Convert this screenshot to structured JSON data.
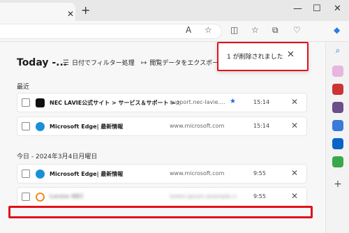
{
  "window": {
    "tab_close": "✕",
    "new_tab": "+",
    "minimize": "—",
    "maximize": "☐",
    "close": "✕"
  },
  "toolbar": {
    "read_aloud": "A",
    "favorite": "☆",
    "split": "◫",
    "favorites_bar": "☆",
    "collections": "⧉",
    "extensions": "♡",
    "copilot": "◆"
  },
  "page": {
    "title": "Today -...",
    "filter_label": "日付でフィルター処理",
    "export_label": "閲覧データをエクスポート"
  },
  "toast": {
    "message": "1 が削除されました",
    "close": "✕"
  },
  "sections": [
    {
      "label": "最近",
      "rows": [
        {
          "title": "NEC LAVIE公式サイト > サービス＆サポート > ホ...",
          "url": "support.nec-lavie....",
          "starred": true,
          "time": "15:14",
          "favicon": "nec"
        },
        {
          "title": "Microsoft Edge| 最新情報",
          "url": "www.microsoft.com",
          "starred": false,
          "time": "15:14",
          "favicon": "edge"
        }
      ]
    },
    {
      "label": "今日 - 2024年3月4日月曜日",
      "rows": [
        {
          "title": "Microsoft Edge| 最新情報",
          "url": "www.microsoft.com",
          "starred": false,
          "time": "9:55",
          "favicon": "edge"
        },
        {
          "title": "Lorem NEC",
          "url": "lorem.ipsum.example.com",
          "starred": false,
          "time": "9:55",
          "favicon": "orange",
          "blurred": true
        }
      ]
    }
  ],
  "icons": {
    "star": "★",
    "delete": "✕"
  },
  "colors": {
    "accent": "#1a6fd8",
    "highlight": "#e0121b",
    "edge": "#1b8fd8"
  }
}
